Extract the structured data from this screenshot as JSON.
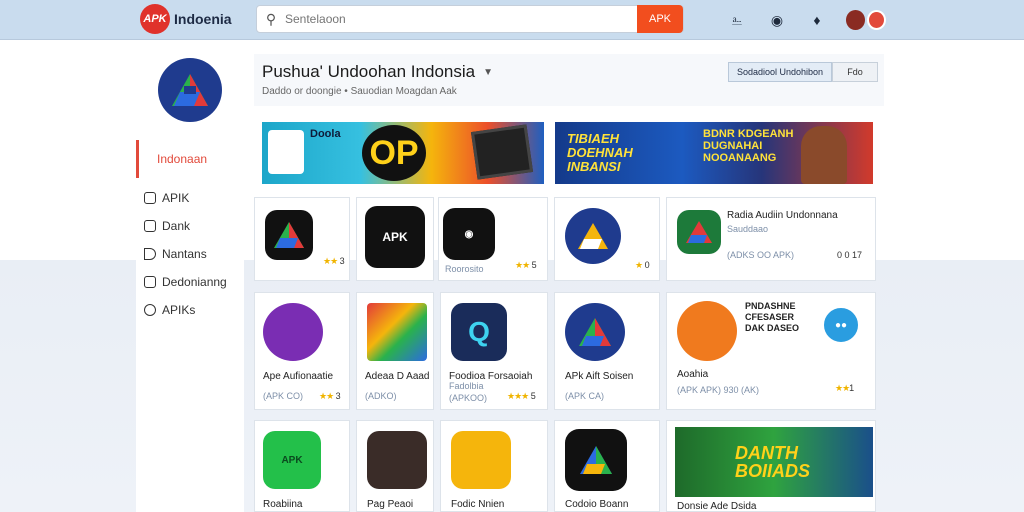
{
  "header": {
    "logo_mark": "APK",
    "logo_text": "Indoenia",
    "search_placeholder": "Sentelaoon",
    "search_button": "APK"
  },
  "sidebar": {
    "active_label": "Indonaan",
    "items": [
      {
        "label": "APIK"
      },
      {
        "label": "Dank"
      },
      {
        "label": "Nantans"
      },
      {
        "label": "Dedonianng"
      },
      {
        "label": "APIKs"
      }
    ]
  },
  "title": {
    "heading": "Pushua' Undoohan Indonsia",
    "subtitle": "Daddo or doongie • Sauodian Moagdan Aak",
    "primary_button": "Sodadiool Undohibon",
    "secondary_button": "Fdo"
  },
  "banners": {
    "left_text": "Doola",
    "left_mark": "OP",
    "right_title": "TIBIAEH DOEHNAH INBANSI",
    "right_sub": "BDNR KDGEANH DUGNAHAI NOOANAANG"
  },
  "featured_apps": {
    "row1": [
      {
        "name": "",
        "tag": "",
        "rating": "3",
        "icon_label": "APK"
      },
      {
        "name": "",
        "tag": "",
        "rating": "",
        "icon_label": "APK"
      },
      {
        "name": "",
        "tag": "Roorosito",
        "rating": "5",
        "icon_label": ""
      },
      {
        "name": "",
        "tag": "",
        "rating": "0",
        "icon_label": ""
      }
    ],
    "row1_wide": {
      "name": "Radia Audiin Undonnana",
      "sub": "Sauddaao",
      "tag": "(ADKS OO APK)",
      "rating": "0 0 17"
    },
    "row2": [
      {
        "name": "Ape Aufionaatie",
        "tag": "(APK CO)",
        "rating": "3"
      },
      {
        "name": "Adeaa D Aaad",
        "tag": "(ADKO)",
        "rating": ""
      },
      {
        "name": "Foodioa Forsaoiah",
        "sub": "Fadolbia",
        "tag": "(APKOO)",
        "rating": "5"
      },
      {
        "name": "APk Aift Soisen",
        "tag": "(APK CA)",
        "rating": ""
      }
    ],
    "row2_wide": {
      "name": "Aoahia",
      "headline": "PNDASHNE CFESASER DAK DASEO",
      "tag": "(APK APK) 930 (AK)",
      "rating": "1"
    },
    "row3": [
      {
        "name": "Roabiina",
        "icon_label": "APK"
      },
      {
        "name": "Pag Peaoi"
      },
      {
        "name": "Fodic Nnien"
      },
      {
        "name": "Codoio Boann"
      }
    ],
    "row3_wide": {
      "name": "Donsie Ade Dsida",
      "headline": "DANTH BOIIADS"
    }
  }
}
